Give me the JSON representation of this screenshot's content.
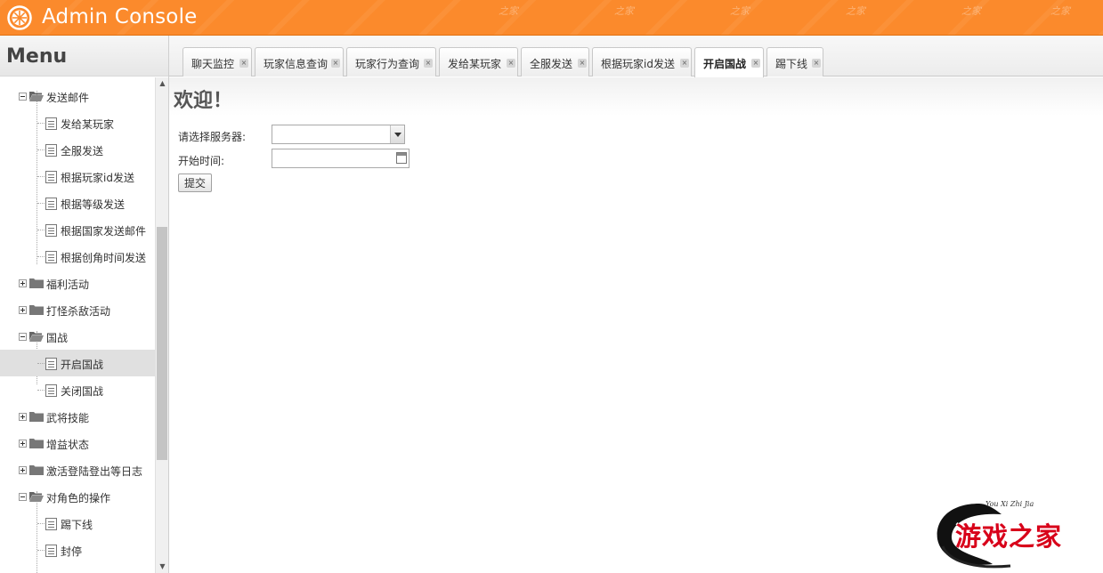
{
  "header": {
    "title": "Admin Console",
    "watermark": "之家"
  },
  "sidebar": {
    "title": "Menu",
    "items": [
      {
        "label": "发送邮件",
        "type": "folder",
        "expanded": true
      },
      {
        "label": "发给某玩家",
        "type": "page"
      },
      {
        "label": "全服发送",
        "type": "page"
      },
      {
        "label": "根据玩家id发送",
        "type": "page"
      },
      {
        "label": "根据等级发送",
        "type": "page"
      },
      {
        "label": "根据国家发送邮件",
        "type": "page"
      },
      {
        "label": "根据创角时间发送",
        "type": "page"
      },
      {
        "label": "福利活动",
        "type": "folder",
        "expanded": false
      },
      {
        "label": "打怪杀敌活动",
        "type": "folder",
        "expanded": false
      },
      {
        "label": "国战",
        "type": "folder",
        "expanded": true
      },
      {
        "label": "开启国战",
        "type": "page",
        "selected": true
      },
      {
        "label": "关闭国战",
        "type": "page"
      },
      {
        "label": "武将技能",
        "type": "folder",
        "expanded": false
      },
      {
        "label": "增益状态",
        "type": "folder",
        "expanded": false
      },
      {
        "label": "激活登陆登出等日志",
        "type": "folder",
        "expanded": false
      },
      {
        "label": "对角色的操作",
        "type": "folder",
        "expanded": true
      },
      {
        "label": "踢下线",
        "type": "page"
      },
      {
        "label": "封停",
        "type": "page"
      }
    ]
  },
  "tabs": [
    {
      "label": "聊天监控",
      "active": false
    },
    {
      "label": "玩家信息查询",
      "active": false
    },
    {
      "label": "玩家行为查询",
      "active": false
    },
    {
      "label": "发给某玩家",
      "active": false
    },
    {
      "label": "全服发送",
      "active": false
    },
    {
      "label": "根据玩家id发送",
      "active": false
    },
    {
      "label": "开启国战",
      "active": true
    },
    {
      "label": "踢下线",
      "active": false
    }
  ],
  "content": {
    "welcome": "欢迎！",
    "server_label": "请选择服务器:",
    "server_value": "",
    "start_time_label": "开始时间:",
    "start_time_value": "",
    "submit_label": "提交"
  },
  "brand": {
    "sub": "You Xi Zhi Jia",
    "main": "游戏之家"
  },
  "colors": {
    "header": "#fb8a2c",
    "brand_red": "#d8001a",
    "selected_row": "#e0e0e0"
  }
}
